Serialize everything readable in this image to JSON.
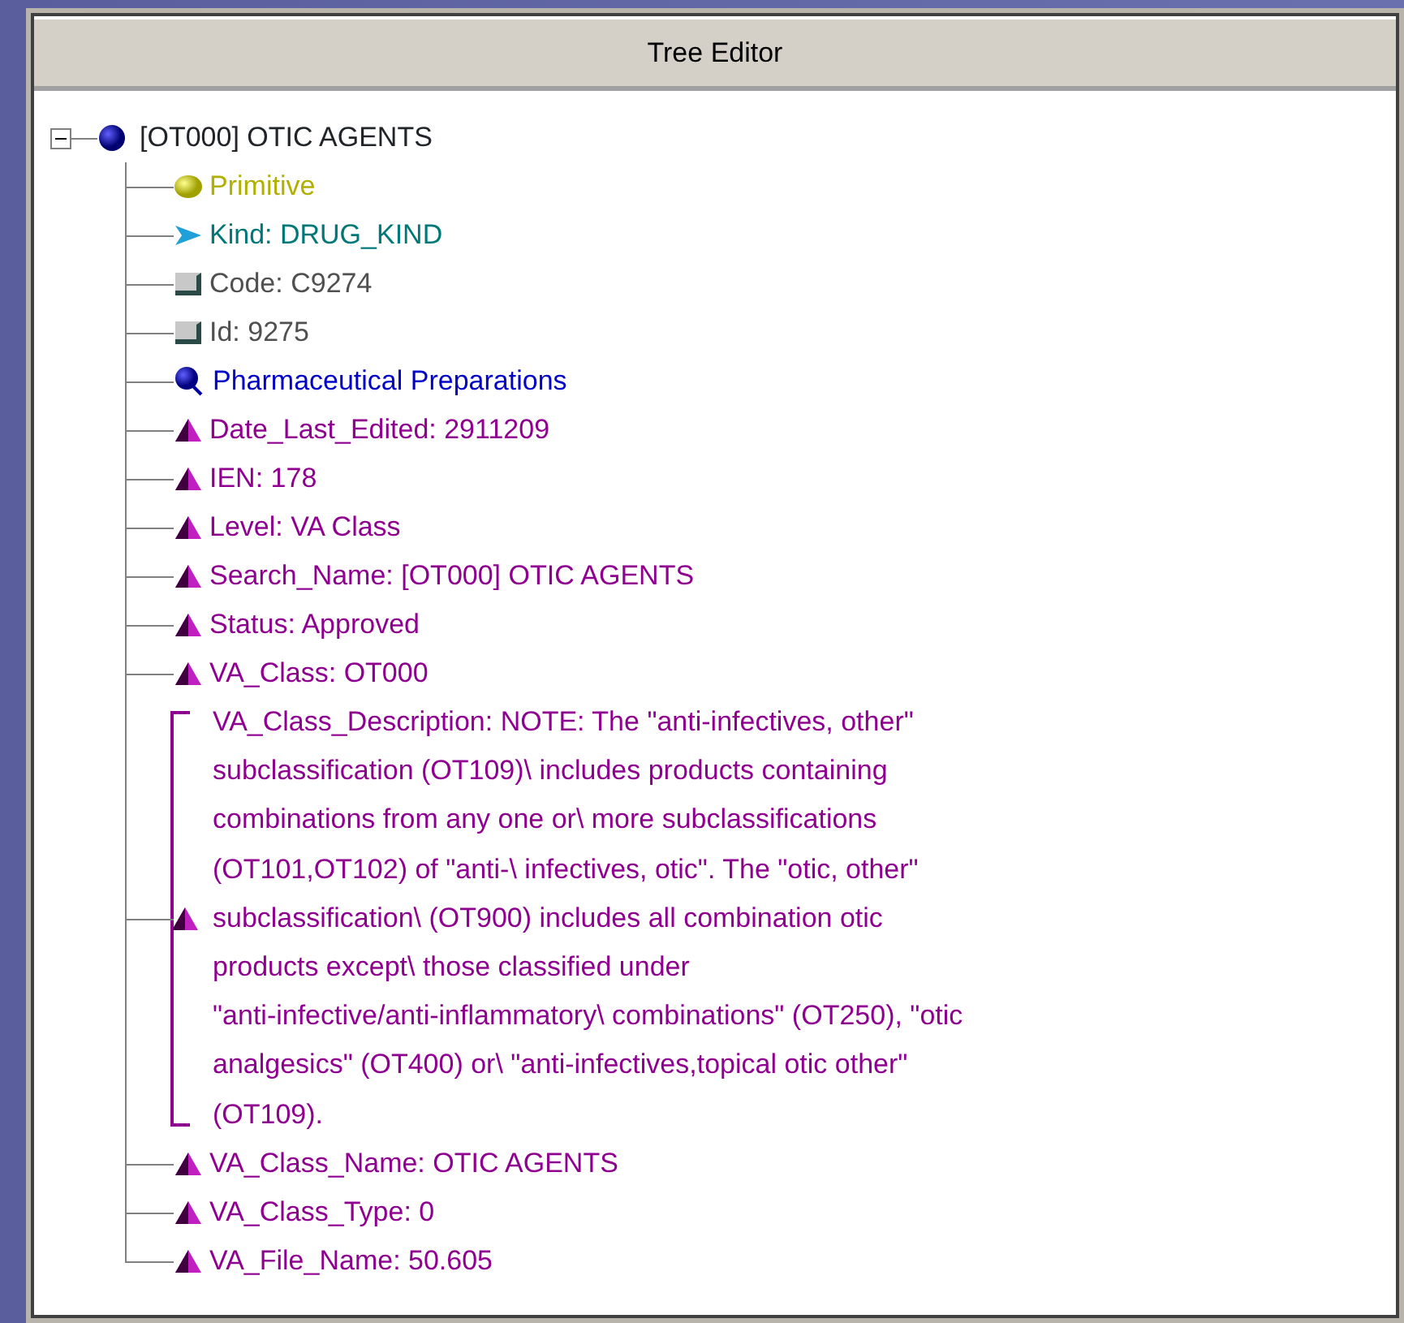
{
  "window": {
    "title": "Tree Editor"
  },
  "tree": {
    "label": "[OT000] OTIC AGENTS",
    "expanded": true,
    "children": [
      {
        "kind": "primitive",
        "text": "Primitive"
      },
      {
        "kind": "kind",
        "text": "Kind:  DRUG_KIND"
      },
      {
        "kind": "code",
        "text": "Code:  C9274"
      },
      {
        "kind": "code",
        "text": "Id:  9275"
      },
      {
        "kind": "link",
        "text": "Pharmaceutical Preparations"
      },
      {
        "kind": "property",
        "text": "Date_Last_Edited: 2911209"
      },
      {
        "kind": "property",
        "text": "IEN: 178"
      },
      {
        "kind": "property",
        "text": "Level: VA Class"
      },
      {
        "kind": "property",
        "text": "Search_Name: [OT000] OTIC AGENTS"
      },
      {
        "kind": "property",
        "text": "Status: Approved"
      },
      {
        "kind": "property",
        "text": "VA_Class: OT000"
      },
      {
        "kind": "property",
        "lines": [
          "VA_Class_Description: NOTE: The \"anti-infectives, other\"",
          "subclassification (OT109)\\ includes products containing",
          "combinations from any one or\\ more subclassifications",
          "(OT101,OT102) of \"anti-\\ infectives, otic\". The \"otic, other\"",
          "subclassification\\ (OT900) includes all combination otic",
          "products except\\ those classified under",
          "\"anti-infective/anti-inflammatory\\ combinations\" (OT250), \"otic",
          "analgesics\" (OT400) or\\ \"anti-infectives,topical otic other\"",
          "(OT109)."
        ]
      },
      {
        "kind": "property",
        "text": "VA_Class_Name: OTIC AGENTS"
      },
      {
        "kind": "property",
        "text": "VA_Class_Type: 0"
      },
      {
        "kind": "property",
        "text": "VA_File_Name: 50.605"
      }
    ]
  }
}
